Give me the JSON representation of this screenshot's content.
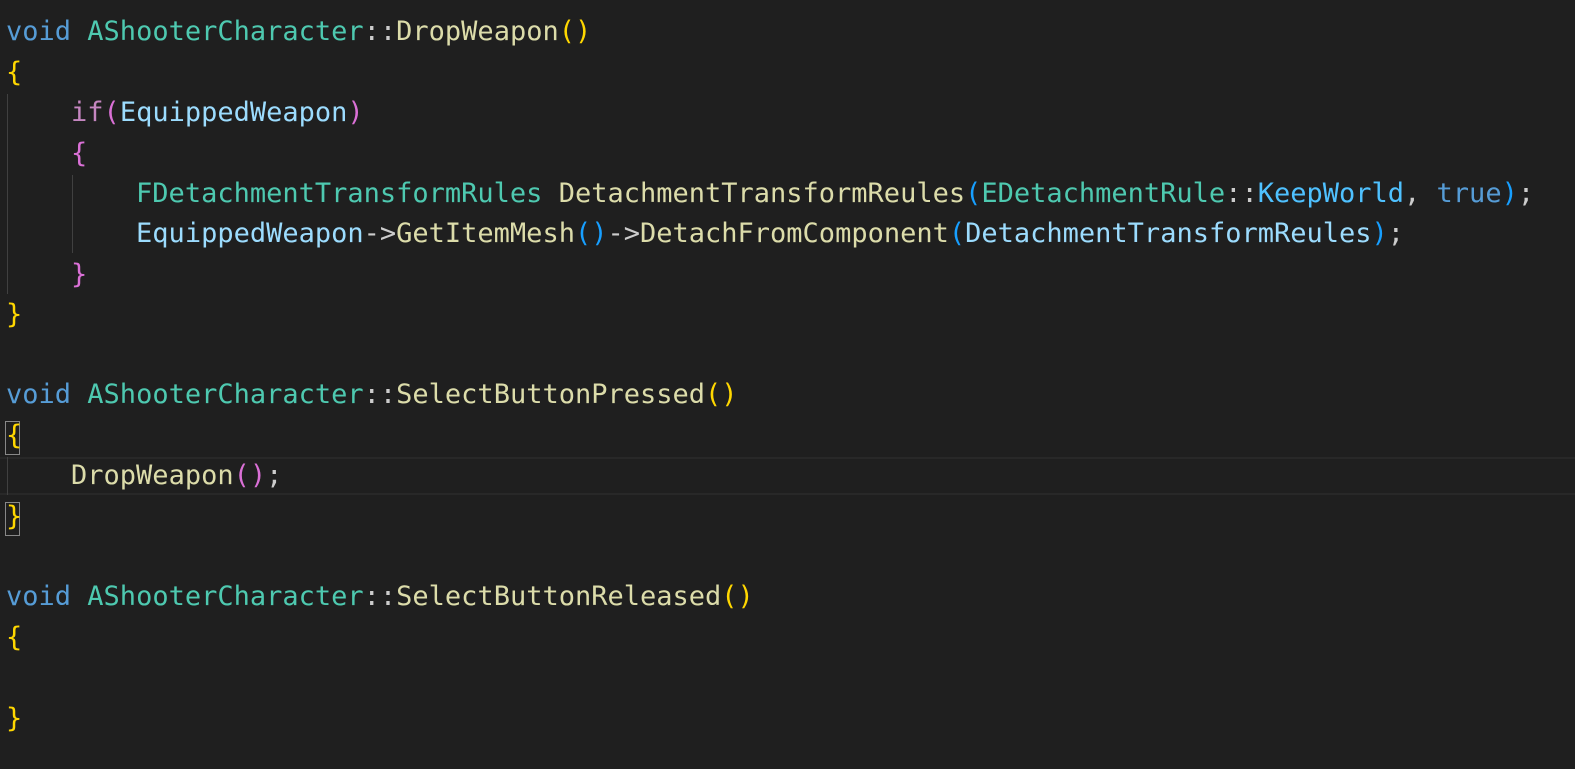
{
  "editor": {
    "language": "cpp",
    "colors": {
      "background": "#1f1f1f",
      "keyword": "#569cd6",
      "control": "#c586c0",
      "type": "#4ec9b0",
      "function": "#dcdcaa",
      "variable": "#9cdcfe",
      "constant": "#4fc1ff",
      "bracket_level_1": "#ffd700",
      "bracket_level_2": "#da70d6",
      "bracket_level_3": "#179fff"
    },
    "tokens": {
      "void": "void",
      "class_name": "AShooterCharacter",
      "scope": "::",
      "fn_drop": "DropWeapon",
      "fn_pressed": "SelectButtonPressed",
      "fn_released": "SelectButtonReleased",
      "paren_open": "(",
      "paren_close": ")",
      "brace_open": "{",
      "brace_close": "}",
      "if_kw": "if",
      "equipped_weapon": "EquippedWeapon",
      "rules_type": "FDetachmentTransformRules",
      "rules_var": "DetachmentTransformReules",
      "rule_enum": "EDetachmentRule",
      "keep_world": "KeepWorld",
      "comma": ", ",
      "true_kw": "true",
      "semicolon": ";",
      "arrow": "->",
      "get_item_mesh": "GetItemMesh",
      "detach_fn": "DetachFromComponent",
      "space": " ",
      "indent1": "    ",
      "indent2": "        "
    }
  }
}
